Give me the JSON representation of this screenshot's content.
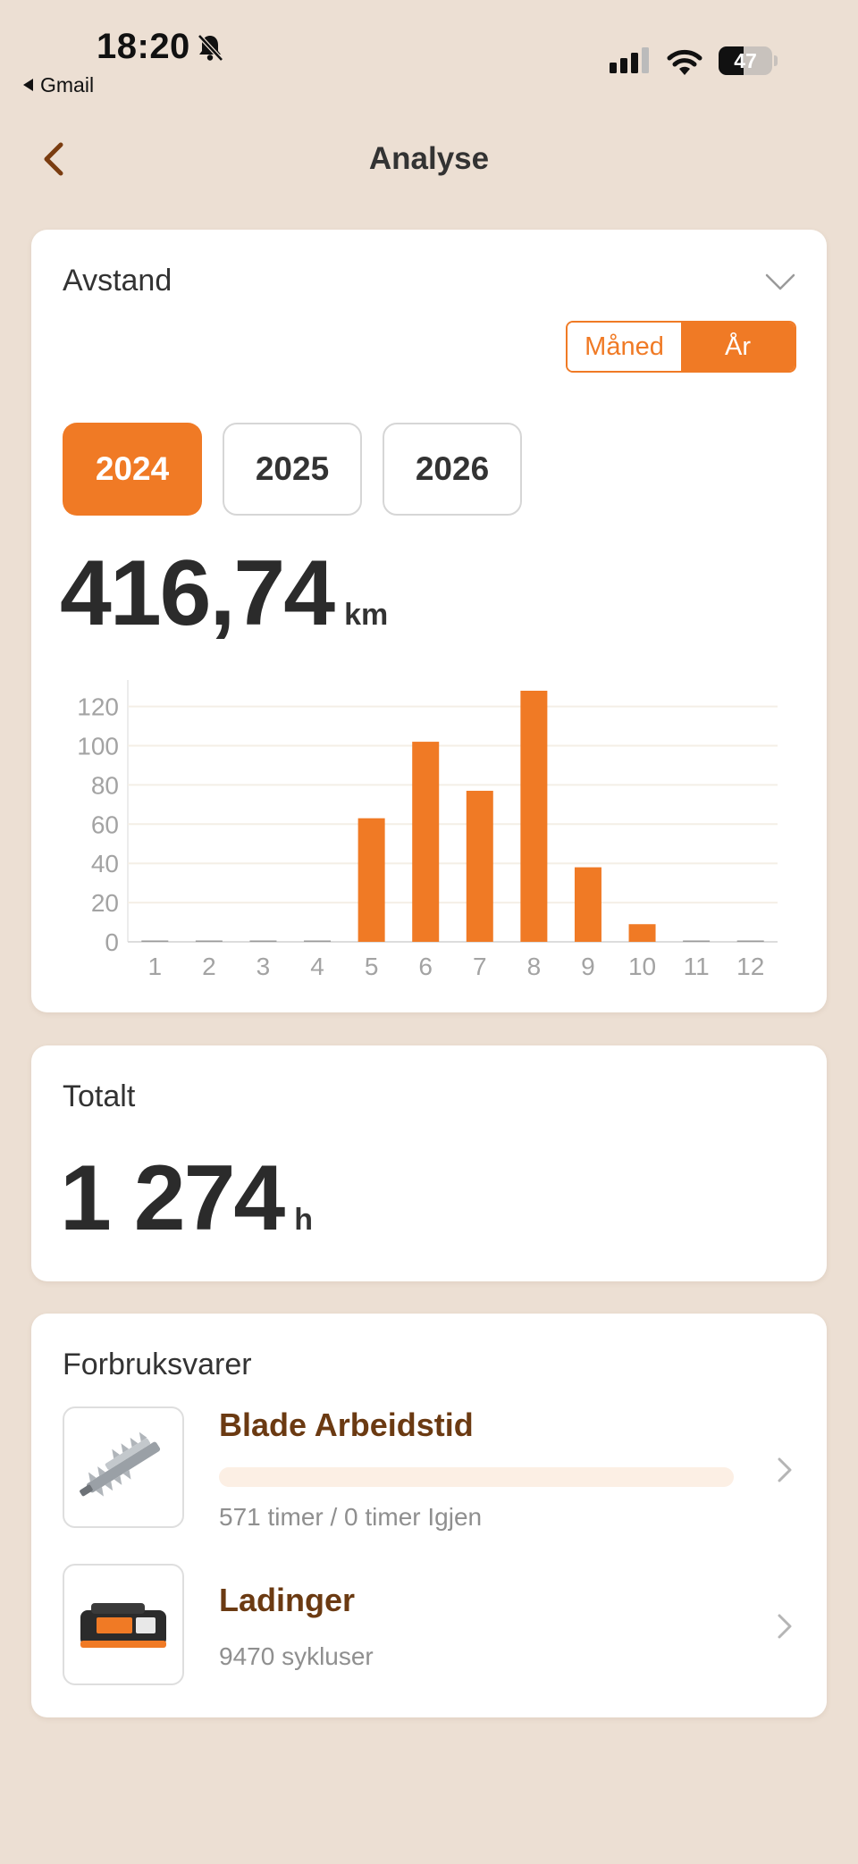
{
  "status_bar": {
    "time": "18:20",
    "back_app": "Gmail",
    "battery": "47"
  },
  "nav": {
    "title": "Analyse"
  },
  "distance": {
    "title": "Avstand",
    "toggle": {
      "month": "Måned",
      "year": "År",
      "selected": "year"
    },
    "years": [
      "2024",
      "2025",
      "2026"
    ],
    "selected_year": "2024",
    "value": "416,74",
    "unit": "km"
  },
  "chart_data": {
    "type": "bar",
    "categories": [
      "1",
      "2",
      "3",
      "4",
      "5",
      "6",
      "7",
      "8",
      "9",
      "10",
      "11",
      "12"
    ],
    "values": [
      0,
      0,
      0,
      0,
      63,
      102,
      77,
      128,
      38,
      9,
      0,
      0
    ],
    "yticks": [
      "0",
      "20",
      "40",
      "60",
      "80",
      "100",
      "120"
    ],
    "ylim": [
      0,
      128
    ],
    "bar_color": "#f07a25",
    "grid": true
  },
  "total": {
    "title": "Totalt",
    "value": "1 274",
    "unit": "h"
  },
  "consumables": {
    "title": "Forbruksvarer",
    "items": [
      {
        "title": "Blade Arbeidstid",
        "subtitle": "571 timer / 0 timer Igjen",
        "progress": 0,
        "icon": "hedge-blade-icon"
      },
      {
        "title": "Ladinger",
        "subtitle": "9470 sykluser",
        "icon": "battery-pack-icon"
      }
    ]
  },
  "colors": {
    "accent": "#f07a25",
    "background": "#ecdfd3",
    "item_title": "#6b3a12"
  }
}
